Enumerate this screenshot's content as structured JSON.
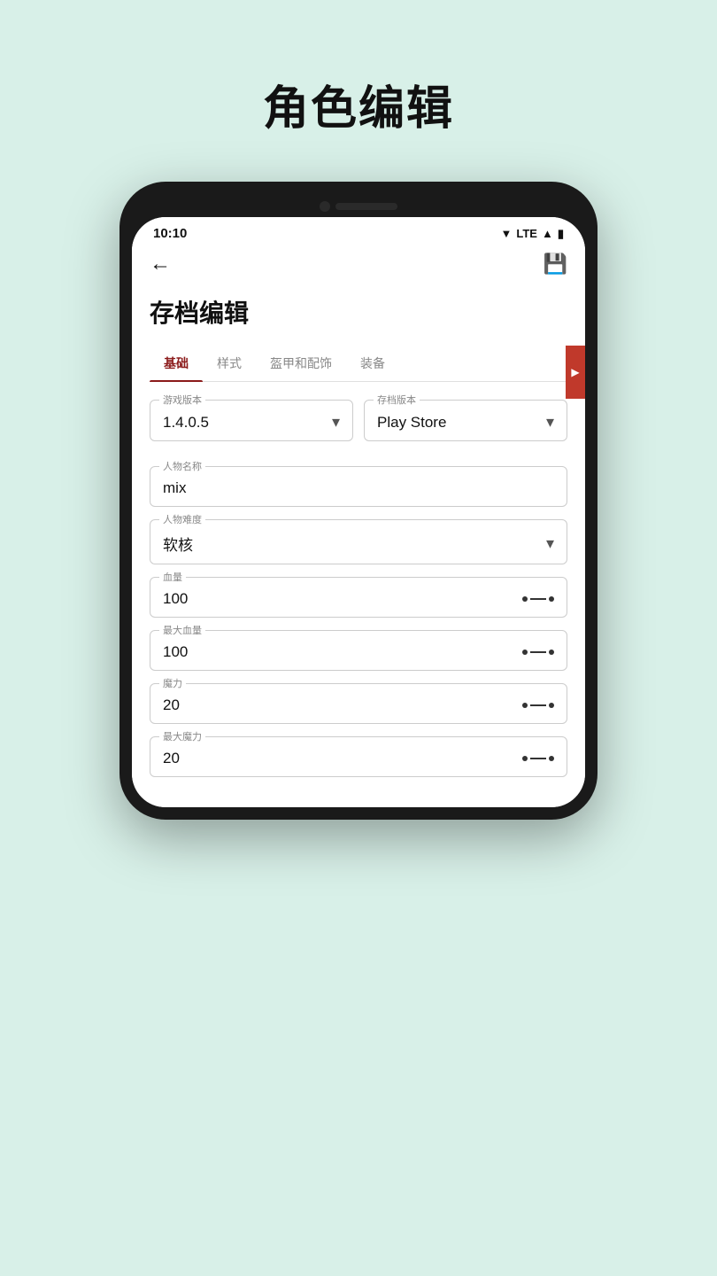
{
  "page": {
    "title": "角色编辑",
    "background": "#d8f0e8"
  },
  "status_bar": {
    "time": "10:10",
    "signal": "▼ LTE",
    "battery": "🔋"
  },
  "app_bar": {
    "back_label": "←",
    "save_label": "💾"
  },
  "screen": {
    "title": "存档编辑",
    "tabs": [
      {
        "label": "基础",
        "active": true
      },
      {
        "label": "样式",
        "active": false
      },
      {
        "label": "盔甲和配饰",
        "active": false
      },
      {
        "label": "装备",
        "active": false
      }
    ]
  },
  "form": {
    "game_version_label": "游戏版本",
    "game_version_value": "1.4.0.5",
    "save_version_label": "存档版本",
    "save_version_value": "Play Store",
    "character_name_label": "人物名称",
    "character_name_value": "mix",
    "difficulty_label": "人物难度",
    "difficulty_value": "软核",
    "hp_label": "血量",
    "hp_value": "100",
    "max_hp_label": "最大血量",
    "max_hp_value": "100",
    "mp_label": "魔力",
    "mp_value": "20",
    "max_mp_label": "最大魔力",
    "max_mp_value": "20"
  }
}
